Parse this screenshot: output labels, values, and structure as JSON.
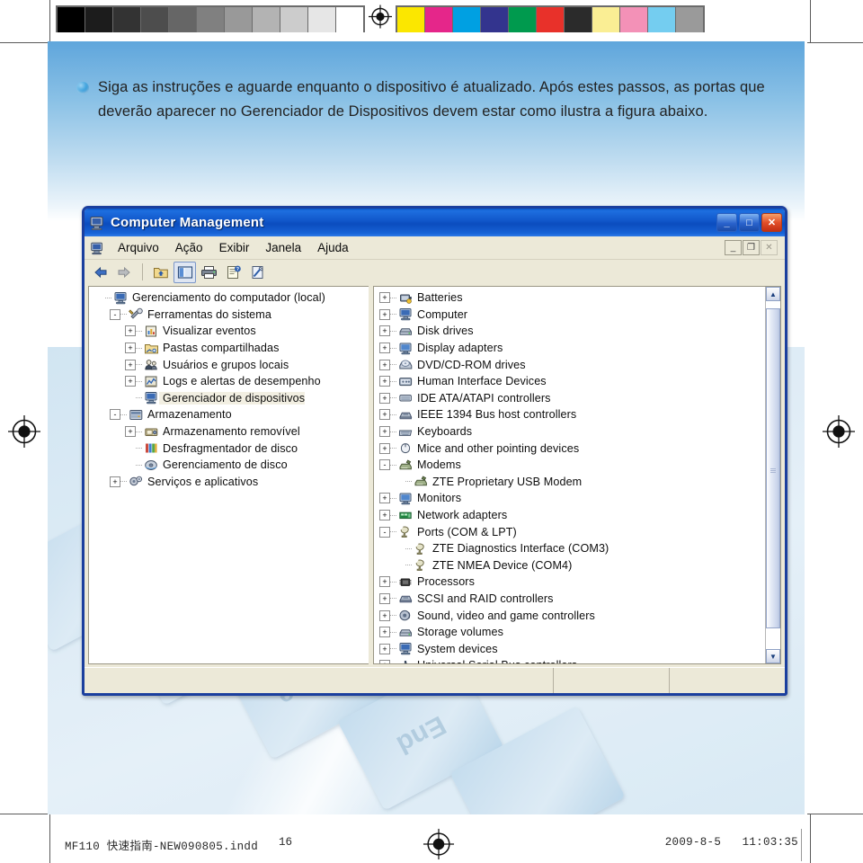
{
  "calibration": {
    "grayscale": [
      "#000000",
      "#1c1c1c",
      "#333333",
      "#4d4d4d",
      "#666666",
      "#808080",
      "#999999",
      "#b3b3b3",
      "#cccccc",
      "#e6e6e6",
      "#ffffff"
    ],
    "colors": [
      "#fbe700",
      "#e5268a",
      "#00a0e2",
      "#33348e",
      "#009a4e",
      "#e8312a",
      "#2b2b2b",
      "#faee94",
      "#f391b7",
      "#74cdf0",
      "#9a9a9a"
    ],
    "registration_mark": "registration-target-icon"
  },
  "instructions": {
    "bullet": "bullet-icon",
    "text": "Siga as instruções e aguarde enquanto o dispositivo é atualizado. Após estes passos, as portas que deverão aparecer no Gerenciador de Dispositivos devem estar como ilustra a figura abaixo."
  },
  "window": {
    "title": "Computer Management",
    "title_icon": "computer-icon",
    "controls": {
      "minimize": "_",
      "maximize": "□",
      "close": "✕"
    },
    "mdi_controls": {
      "minimize": "_",
      "restore": "❐",
      "close": "✕"
    },
    "menu_icon": "computer-icon",
    "menu": [
      "Arquivo",
      "Ação",
      "Exibir",
      "Janela",
      "Ajuda"
    ],
    "toolbar": [
      {
        "name": "back-icon",
        "glyph": "⬅"
      },
      {
        "name": "forward-icon",
        "glyph": "➡"
      },
      {
        "name": "up-one-level-icon",
        "glyph": "folder-up"
      },
      {
        "name": "show-hide-tree-icon",
        "glyph": "panes"
      },
      {
        "name": "print-icon",
        "glyph": "printer"
      },
      {
        "name": "properties-icon",
        "glyph": "properties"
      },
      {
        "name": "help-icon",
        "glyph": "help-doc"
      }
    ],
    "statusbar": {
      "cell1": "",
      "cell2": "",
      "cell3": ""
    }
  },
  "console_tree": {
    "root": {
      "label": "Gerenciamento do computador (local)",
      "icon": "computer-icon",
      "indent": 0,
      "expander": "none"
    },
    "items": [
      {
        "label": "Ferramentas do sistema",
        "icon": "system-tools-icon",
        "indent": 1,
        "expander": "-"
      },
      {
        "label": "Visualizar eventos",
        "icon": "event-viewer-icon",
        "indent": 2,
        "expander": "+"
      },
      {
        "label": "Pastas compartilhadas",
        "icon": "shared-folders-icon",
        "indent": 2,
        "expander": "+"
      },
      {
        "label": "Usuários e grupos locais",
        "icon": "local-users-icon",
        "indent": 2,
        "expander": "+"
      },
      {
        "label": "Logs e alertas de desempenho",
        "icon": "performance-logs-icon",
        "indent": 2,
        "expander": "+"
      },
      {
        "label": "Gerenciador de dispositivos",
        "icon": "device-manager-icon",
        "indent": 2,
        "expander": "none",
        "selected": true
      },
      {
        "label": "Armazenamento",
        "icon": "storage-icon",
        "indent": 1,
        "expander": "-"
      },
      {
        "label": "Armazenamento removível",
        "icon": "removable-storage-icon",
        "indent": 2,
        "expander": "+"
      },
      {
        "label": "Desfragmentador de disco",
        "icon": "defragmenter-icon",
        "indent": 2,
        "expander": "none"
      },
      {
        "label": "Gerenciamento de disco",
        "icon": "disk-management-icon",
        "indent": 2,
        "expander": "none"
      },
      {
        "label": "Serviços e aplicativos",
        "icon": "services-apps-icon",
        "indent": 1,
        "expander": "+"
      }
    ]
  },
  "device_tree": {
    "items": [
      {
        "label": "Batteries",
        "icon": "battery-icon",
        "indent": 0,
        "expander": "+"
      },
      {
        "label": "Computer",
        "icon": "computer-device-icon",
        "indent": 0,
        "expander": "+"
      },
      {
        "label": "Disk drives",
        "icon": "disk-drive-icon",
        "indent": 0,
        "expander": "+"
      },
      {
        "label": "Display adapters",
        "icon": "display-adapter-icon",
        "indent": 0,
        "expander": "+"
      },
      {
        "label": "DVD/CD-ROM drives",
        "icon": "dvd-drive-icon",
        "indent": 0,
        "expander": "+"
      },
      {
        "label": "Human Interface Devices",
        "icon": "hid-icon",
        "indent": 0,
        "expander": "+"
      },
      {
        "label": "IDE ATA/ATAPI controllers",
        "icon": "ide-controller-icon",
        "indent": 0,
        "expander": "+"
      },
      {
        "label": "IEEE 1394 Bus host controllers",
        "icon": "ieee1394-icon",
        "indent": 0,
        "expander": "+"
      },
      {
        "label": "Keyboards",
        "icon": "keyboard-icon",
        "indent": 0,
        "expander": "+"
      },
      {
        "label": "Mice and other pointing devices",
        "icon": "mouse-icon",
        "indent": 0,
        "expander": "+"
      },
      {
        "label": "Modems",
        "icon": "modem-icon",
        "indent": 0,
        "expander": "-"
      },
      {
        "label": "ZTE Proprietary USB Modem",
        "icon": "modem-icon",
        "indent": 1,
        "expander": "none"
      },
      {
        "label": "Monitors",
        "icon": "monitor-icon",
        "indent": 0,
        "expander": "+"
      },
      {
        "label": "Network adapters",
        "icon": "network-adapter-icon",
        "indent": 0,
        "expander": "+"
      },
      {
        "label": "Ports (COM & LPT)",
        "icon": "port-icon",
        "indent": 0,
        "expander": "-"
      },
      {
        "label": "ZTE Diagnostics Interface (COM3)",
        "icon": "port-icon",
        "indent": 1,
        "expander": "none"
      },
      {
        "label": "ZTE NMEA Device (COM4)",
        "icon": "port-icon",
        "indent": 1,
        "expander": "none"
      },
      {
        "label": "Processors",
        "icon": "processor-icon",
        "indent": 0,
        "expander": "+"
      },
      {
        "label": "SCSI and RAID controllers",
        "icon": "scsi-raid-icon",
        "indent": 0,
        "expander": "+"
      },
      {
        "label": "Sound, video and game controllers",
        "icon": "sound-icon",
        "indent": 0,
        "expander": "+"
      },
      {
        "label": "Storage volumes",
        "icon": "storage-volume-icon",
        "indent": 0,
        "expander": "+"
      },
      {
        "label": "System devices",
        "icon": "system-device-icon",
        "indent": 0,
        "expander": "+"
      },
      {
        "label": "Universal Serial Bus controllers",
        "icon": "usb-controller-icon",
        "indent": 0,
        "expander": "+"
      }
    ],
    "scrollbar": {
      "up": "▲",
      "down": "▼"
    }
  },
  "footer": {
    "filename": "MF110 快速指南-NEW090805.indd",
    "page": "16",
    "date": "2009-8-5",
    "time": "11:03:35",
    "registration_mark": "registration-target-icon"
  }
}
